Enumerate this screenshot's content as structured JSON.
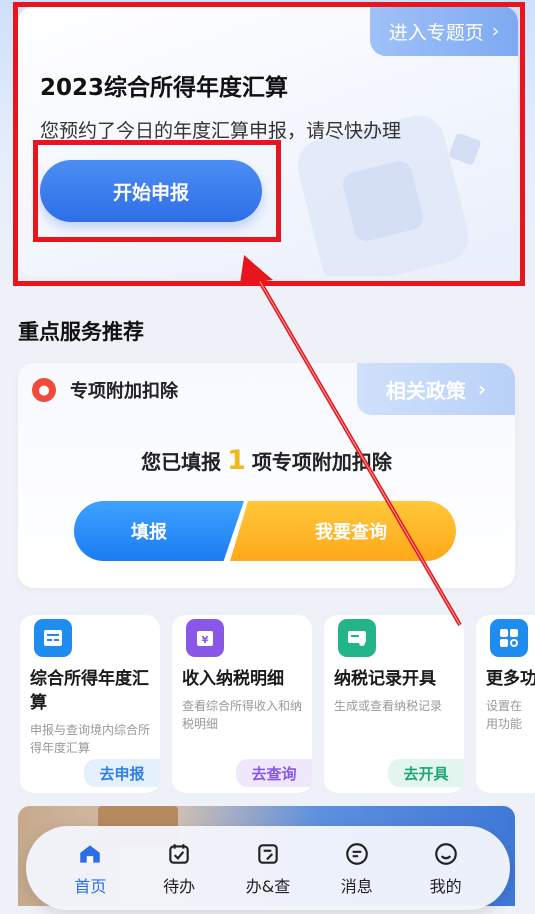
{
  "hero": {
    "topic_link": "进入专题页",
    "title": "2023综合所得年度汇算",
    "subtitle": "您预约了今日的年度汇算申报，请尽快办理",
    "start_button": "开始申报"
  },
  "section": {
    "title": "重点服务推荐"
  },
  "deduction": {
    "title": "专项附加扣除",
    "policy_link": "相关政策",
    "filled_prefix": "您已填报",
    "filled_count": "1",
    "filled_suffix": "项专项附加扣除",
    "fill_button": "填报",
    "query_button": "我要查询"
  },
  "tiles": [
    {
      "title": "综合所得年度汇算",
      "desc": "申报与查询境内综合所得年度汇算",
      "action": "去申报",
      "icon": "calculator-icon",
      "color": "#1f8cf0",
      "action_color": "#2f7fe8",
      "action_bg": "#e5f0fd"
    },
    {
      "title": "收入纳税明细",
      "desc": "查看综合所得收入和纳税明细",
      "action": "去查询",
      "icon": "wallet-icon",
      "color": "#8a58e8",
      "action_color": "#8a58e8",
      "action_bg": "#efe8fd"
    },
    {
      "title": "纳税记录开具",
      "desc": "生成或查看纳税记录",
      "action": "去开具",
      "icon": "certificate-icon",
      "color": "#22b58a",
      "action_color": "#1fa57b",
      "action_bg": "#e2f6ef"
    },
    {
      "title": "更多功",
      "desc": "设置在用功能",
      "action": "",
      "icon": "grid-search-icon",
      "color": "#1f8cf0",
      "action_color": "#2f7fe8",
      "action_bg": "#e5f0fd"
    }
  ],
  "nav": [
    {
      "label": "首页",
      "icon": "home-icon",
      "active": true
    },
    {
      "label": "待办",
      "icon": "calendar-check-icon",
      "active": false
    },
    {
      "label": "办&查",
      "icon": "form-edit-icon",
      "active": false
    },
    {
      "label": "消息",
      "icon": "chat-icon",
      "active": false
    },
    {
      "label": "我的",
      "icon": "smile-icon",
      "active": false
    }
  ],
  "colors": {
    "annotation_red": "#e8161c",
    "primary_blue": "#2f6fe6",
    "highlight_yellow": "#f5b81b"
  }
}
